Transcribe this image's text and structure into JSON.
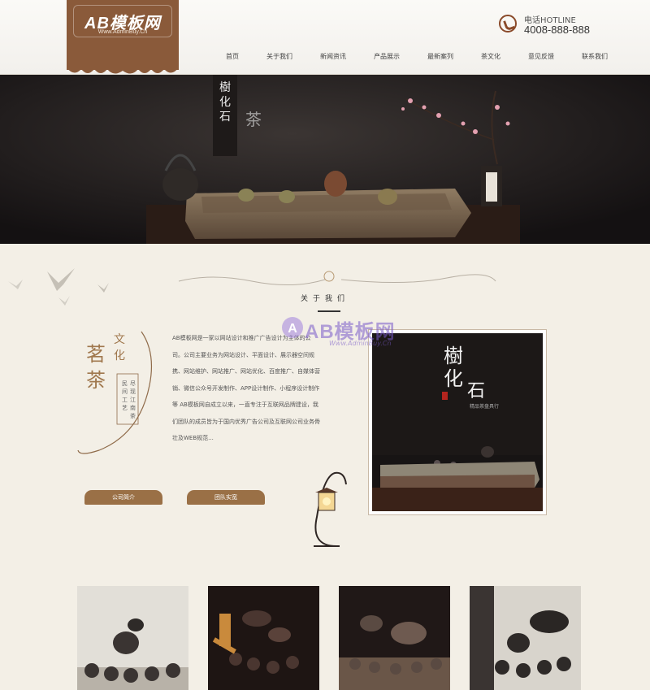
{
  "header": {
    "logo_brand": "AB模板网",
    "logo_sub": "Www.AdminBuy.Cn",
    "hotline_label": "电话HOTLINE",
    "hotline_number": "4008-888-888"
  },
  "nav": {
    "items": [
      "首页",
      "关于我们",
      "新闻资讯",
      "产品展示",
      "最新案列",
      "茶文化",
      "意见反馈",
      "联系我们"
    ]
  },
  "banner": {
    "seal_text": "樹化石"
  },
  "about": {
    "section_title": "关于我们",
    "side_words": [
      "文化",
      "茗茶",
      "民间工艺",
      "尽现江南茶萃"
    ],
    "paragraph": "AB模板网是一家以网站设计和推广广告设计为主体的公司。公司主要业务为网站设计、平面设计、展示器空间规携、网站维护、网站推广、网站优化、百度推广、自媒体营销、微信公众号开发制作、APP设计制作、小程序设计制作等 AB模板网自成立以来，一直专注于互联网品牌建设，我们团队的成员皆为于国内优秀广告公司及互联网公司业务骨壮及WEB规范...",
    "btn_intro": "公司简介",
    "btn_team": "团队实宽",
    "photo_title": "樹化石",
    "photo_caption": "精品茶盘具行",
    "watermark_text": "AB模板网",
    "watermark_url": "Www.AdminBuy.Cn"
  },
  "colors": {
    "brand_brown": "#8a5a3a",
    "button_brown": "#9a7046",
    "page_bg": "#f3efe6",
    "watermark_purple": "#7a5ac8"
  },
  "icons": {
    "phone": "phone-icon",
    "lantern": "lantern-icon",
    "birds": "bird-icons"
  }
}
